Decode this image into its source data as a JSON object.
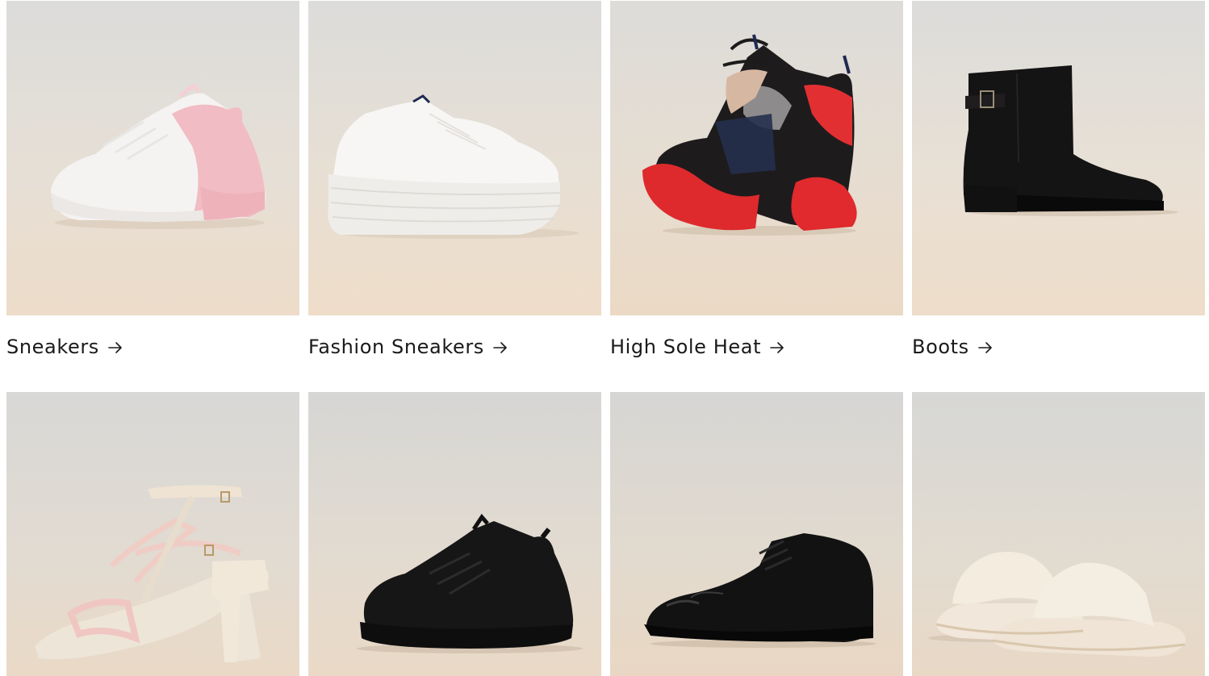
{
  "collections": [
    {
      "label": "Sneakers",
      "icon": "arrow-right-icon",
      "image": "pink-white-chunky-sneaker"
    },
    {
      "label": "Fashion Sneakers",
      "icon": "arrow-right-icon",
      "image": "white-platform-sneaker"
    },
    {
      "label": "High Sole Heat",
      "icon": "arrow-right-icon",
      "image": "red-black-high-sole-sneaker"
    },
    {
      "label": "Boots",
      "icon": "arrow-right-icon",
      "image": "black-ankle-boot"
    },
    {
      "label": "",
      "icon": "",
      "image": "cream-block-heel-sandal"
    },
    {
      "label": "",
      "icon": "",
      "image": "black-chunky-sneaker"
    },
    {
      "label": "",
      "icon": "",
      "image": "black-oxford-shoe"
    },
    {
      "label": "",
      "icon": "",
      "image": "cream-slide-slippers"
    }
  ],
  "colors": {
    "background": "#ffffff",
    "text": "#1a1a1a",
    "photo_top": "#d9d9d7",
    "photo_bottom": "#ecdccb"
  }
}
